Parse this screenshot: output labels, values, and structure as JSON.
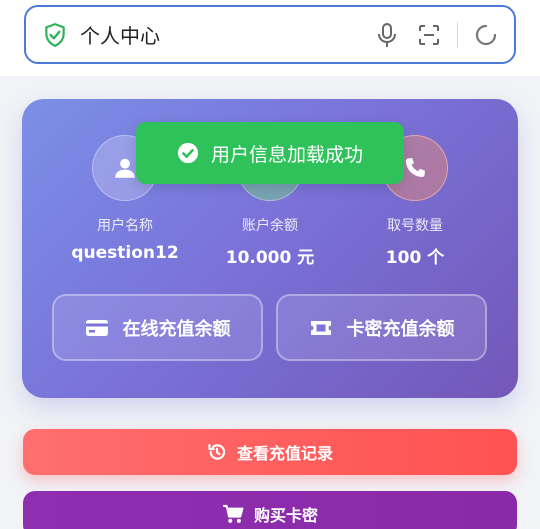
{
  "search": {
    "value": "个人中心",
    "icons": [
      "shield-check-icon",
      "microphone-icon",
      "scan-icon",
      "refresh-icon"
    ]
  },
  "profile": {
    "stats": [
      {
        "label": "用户名称",
        "value": "question12",
        "icon": "user-icon"
      },
      {
        "label": "账户余额",
        "value": "10.000 元",
        "icon": "wallet-icon"
      },
      {
        "label": "取号数量",
        "value": "100 个",
        "icon": "phone-icon"
      }
    ],
    "buttons": {
      "online_recharge": "在线充值余额",
      "card_recharge": "卡密充值余额"
    }
  },
  "toast": {
    "message": "用户信息加载成功"
  },
  "actions": {
    "history": "查看充值记录",
    "buy_card": "购买卡密"
  },
  "colors": {
    "accent_blue": "#4a7bd9",
    "toast_green": "#2fc25b",
    "history_red": "#ff5c5c",
    "buy_purple": "#8a2aa8"
  }
}
